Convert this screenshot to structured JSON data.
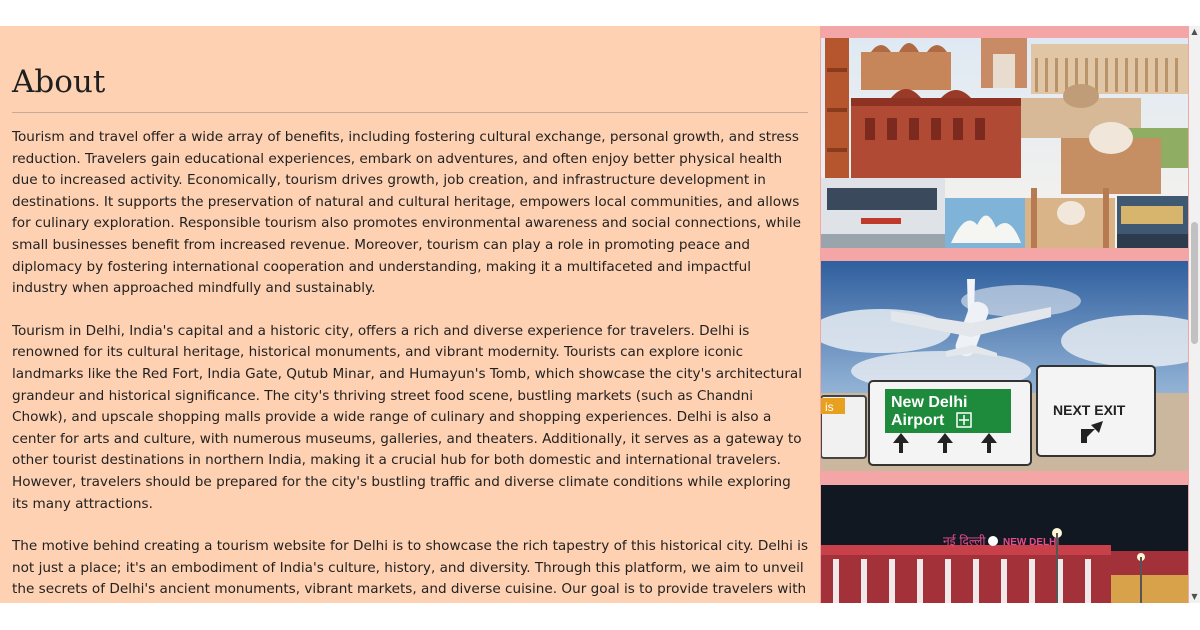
{
  "about": {
    "heading": "About",
    "paragraphs": [
      "Tourism and travel offer a wide array of benefits, including fostering cultural exchange, personal growth, and stress reduction. Travelers gain educational experiences, embark on adventures, and often enjoy better physical health due to increased activity. Economically, tourism drives growth, job creation, and infrastructure development in destinations. It supports the preservation of natural and cultural heritage, empowers local communities, and allows for culinary exploration. Responsible tourism also promotes environmental awareness and social connections, while small businesses benefit from increased revenue. Moreover, tourism can play a role in promoting peace and diplomacy by fostering international cooperation and understanding, making it a multifaceted and impactful industry when approached mindfully and sustainably.",
      "Tourism in Delhi, India's capital and a historic city, offers a rich and diverse experience for travelers. Delhi is renowned for its cultural heritage, historical monuments, and vibrant modernity. Tourists can explore iconic landmarks like the Red Fort, India Gate, Qutub Minar, and Humayun's Tomb, which showcase the city's architectural grandeur and historical significance. The city's thriving street food scene, bustling markets (such as Chandni Chowk), and upscale shopping malls provide a wide range of culinary and shopping experiences. Delhi is also a center for arts and culture, with numerous museums, galleries, and theaters. Additionally, it serves as a gateway to other tourist destinations in northern India, making it a crucial hub for both domestic and international travelers. However, travelers should be prepared for the city's bustling traffic and diverse climate conditions while exploring its many attractions.",
      "The motive behind creating a tourism website for Delhi is to showcase the rich tapestry of this historical city. Delhi is not just a place; it's an embodiment of India's culture, history, and diversity. Through this platform, we aim to unveil the secrets of Delhi's ancient monuments, vibrant markets, and diverse cuisine. Our goal is to provide travelers with the tools and information they need to experience Delhi's charm firsthand, to immerse themselves in its cultural heritage, and to create"
    ]
  },
  "gallery": {
    "sign_city": "New Delhi",
    "sign_airport": "Airport",
    "sign_exit": "NEXT EXIT",
    "sign_partial": "is",
    "station_hindi": "नई दिल्ली",
    "station_label": "NEW DELHI"
  },
  "colors": {
    "page_background": "#ffd1b3",
    "gallery_background": "#f4a5a5",
    "sign_green": "#1e8a3c"
  }
}
